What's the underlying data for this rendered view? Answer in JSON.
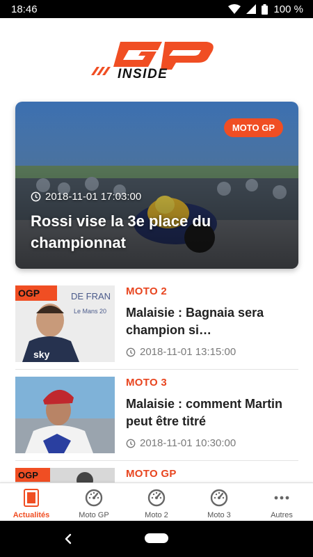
{
  "status_bar": {
    "time": "18:46",
    "battery": "100 %",
    "icons": [
      "wifi-icon",
      "signal-icon",
      "battery-icon"
    ]
  },
  "logo": {
    "text": "GP INSIDE",
    "colors": {
      "primary": "#f04e23",
      "secondary": "#000000"
    }
  },
  "hero": {
    "badge": "MOTO GP",
    "datetime": "2018-11-01 17:03:00",
    "title": "Rossi vise la 3e place du championnat"
  },
  "articles": [
    {
      "category": "MOTO 2",
      "title": "Malaisie : Bagnaia sera champion si…",
      "datetime": "2018-11-01 13:15:00"
    },
    {
      "category": "MOTO 3",
      "title": "Malaisie : comment Martin peut être titré",
      "datetime": "2018-11-01 10:30:00"
    },
    {
      "category": "MOTO GP",
      "title": "",
      "datetime": ""
    }
  ],
  "bottom_nav": {
    "items": [
      {
        "label": "Actualités",
        "icon": "news-icon",
        "active": true
      },
      {
        "label": "Moto GP",
        "icon": "speedometer-icon"
      },
      {
        "label": "Moto 2",
        "icon": "speedometer-icon"
      },
      {
        "label": "Moto 3",
        "icon": "speedometer-icon"
      },
      {
        "label": "Autres",
        "icon": "more-icon"
      }
    ]
  },
  "colors": {
    "accent": "#f04e23",
    "category": "#e8451f",
    "meta": "#7a7a7a"
  }
}
